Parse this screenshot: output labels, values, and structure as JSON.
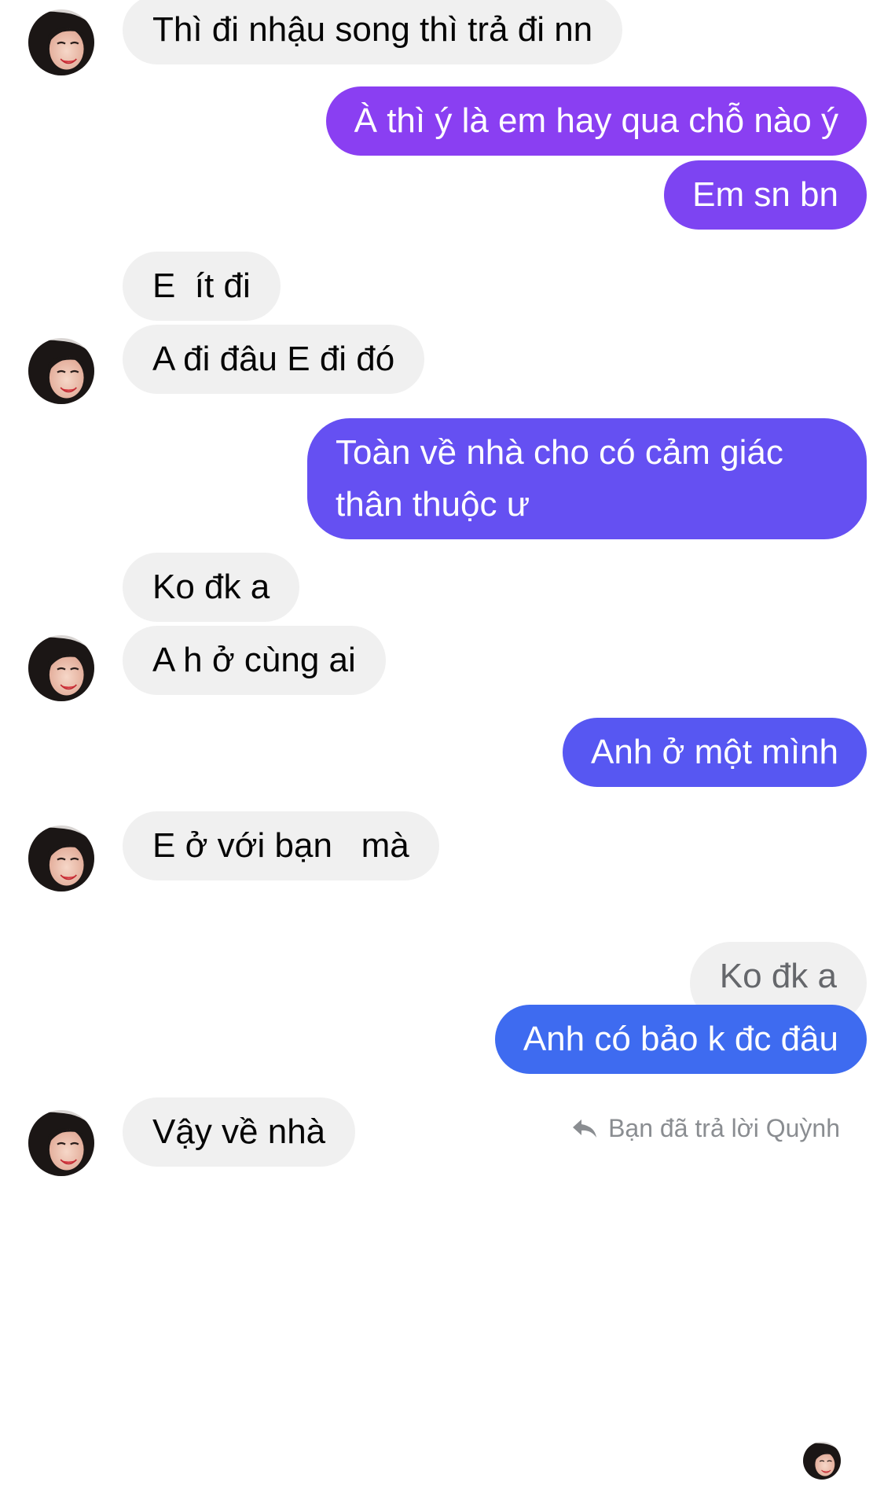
{
  "conversation": {
    "messages": [
      {
        "sender": "other",
        "text": "Thì đi nhậu song thì trả đi nn"
      },
      {
        "sender": "me",
        "text": "À thì ý là em hay qua chỗ nào ý"
      },
      {
        "sender": "me",
        "text": "Em sn bn"
      },
      {
        "sender": "other",
        "text": "E  ít đi"
      },
      {
        "sender": "other",
        "text": "A đi đâu E đi đó"
      },
      {
        "sender": "me",
        "text": "Toàn về nhà cho có cảm giác thân thuộc ư"
      },
      {
        "sender": "other",
        "text": "Ko đk a"
      },
      {
        "sender": "other",
        "text": "A h ở cùng ai"
      },
      {
        "sender": "me",
        "text": "Anh ở một mình"
      },
      {
        "sender": "other",
        "text": "E ở với bạn   mà"
      },
      {
        "sender": "me",
        "text": "Anh có bảo k đc đâu"
      },
      {
        "sender": "other",
        "text": "Vậy về nhà"
      }
    ],
    "reply_context": {
      "label": "Bạn đã trả lời Quỳnh",
      "quoted_text": "Ko đk a",
      "icon": "reply-arrow-icon"
    },
    "read_receipt": {
      "icon": "seen-avatar"
    },
    "colors": {
      "incoming_bubble": "#f0f0f0",
      "incoming_text": "#050505",
      "outgoing_gradient_top": "#8a3ff2",
      "outgoing_gradient_bottom": "#3e6bf0",
      "outgoing_text": "#ffffff",
      "meta_text": "#8a8d91"
    }
  }
}
